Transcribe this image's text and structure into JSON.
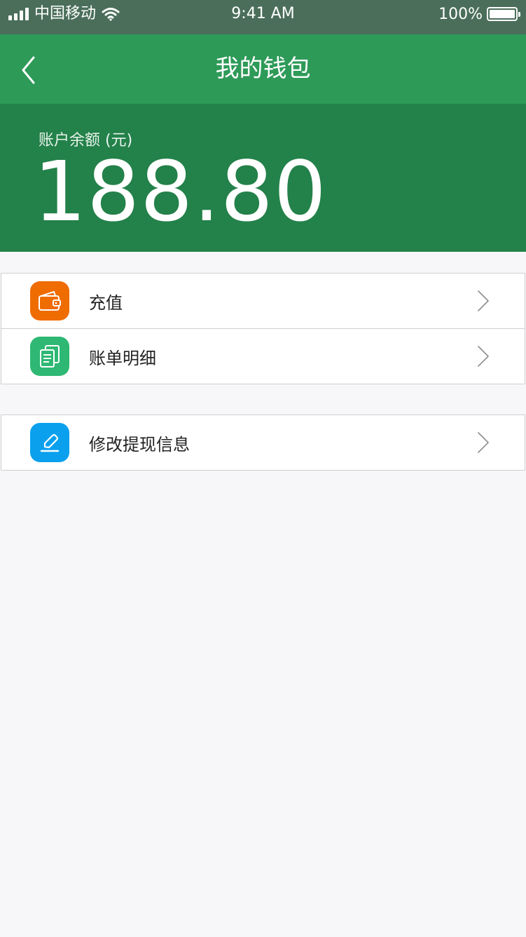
{
  "status_bar": {
    "carrier": "中国移动",
    "time": "9:41 AM",
    "battery": "100%",
    "icons": [
      "signal-icon",
      "wifi-icon",
      "battery-icon"
    ]
  },
  "nav": {
    "title": "我的钱包",
    "back_icon": "chevron-left-icon"
  },
  "balance": {
    "label": "账户余额 (元)",
    "amount": "188.80"
  },
  "menu_groups": [
    {
      "items": [
        {
          "label": "充值",
          "icon": "wallet-icon",
          "icon_color": "#ef6c00"
        },
        {
          "label": "账单明细",
          "icon": "documents-icon",
          "icon_color": "#2eb873"
        }
      ]
    },
    {
      "items": [
        {
          "label": "修改提现信息",
          "icon": "edit-icon",
          "icon_color": "#0aa0ee"
        }
      ]
    }
  ],
  "colors": {
    "nav_bg": "#2e9a58",
    "balance_bg": "#23814a",
    "page_bg": "#f7f7f9"
  }
}
